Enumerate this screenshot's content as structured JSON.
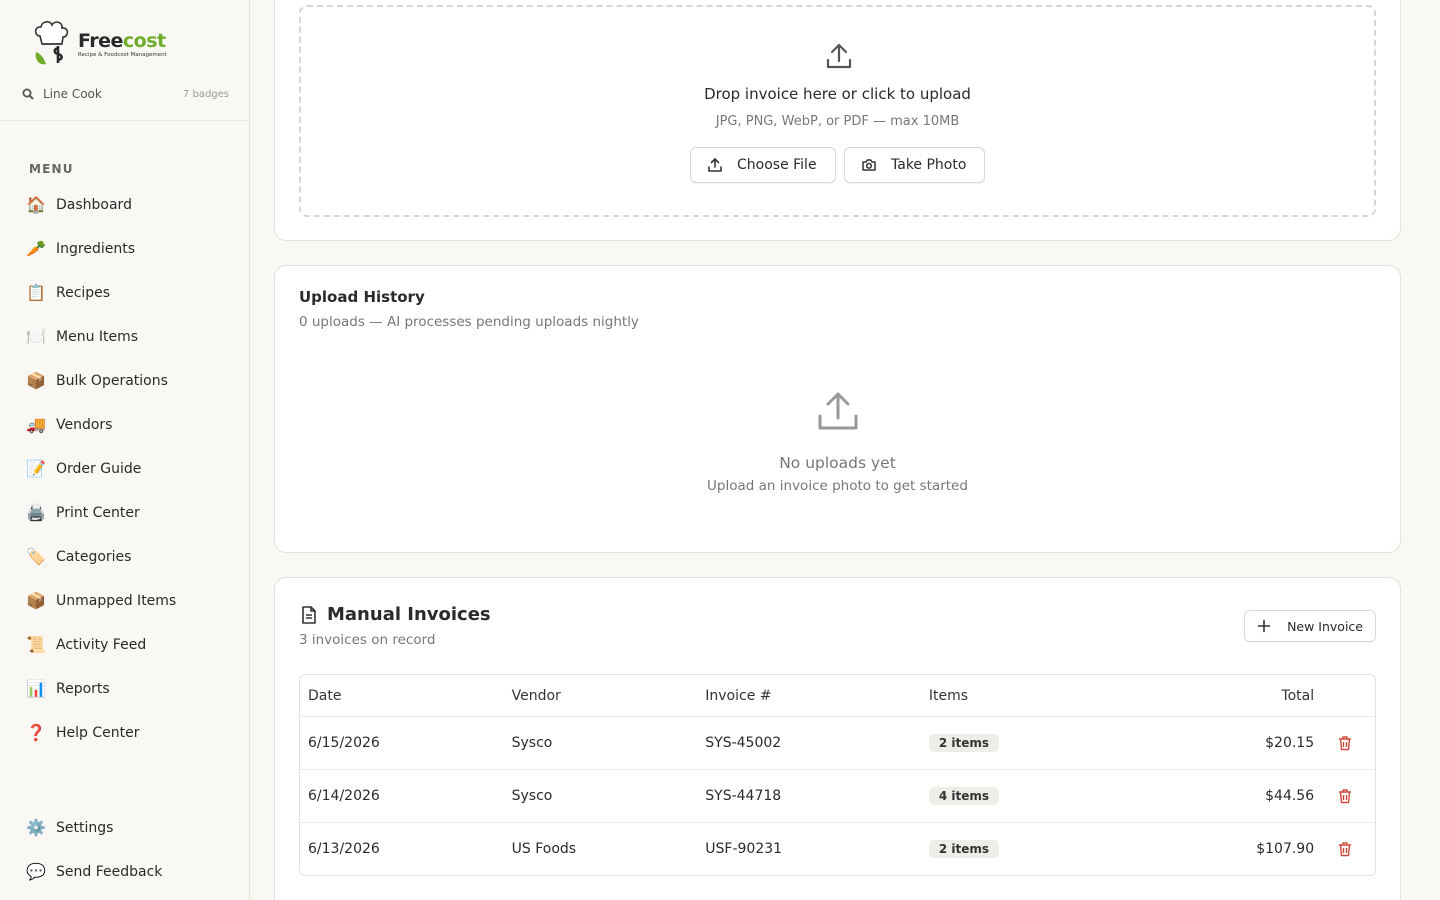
{
  "app": {
    "logo_name_prefix": "Free",
    "logo_name_accent": "cost",
    "logo_tagline": "Recipe & Foodcost Management"
  },
  "user": {
    "role": "Line Cook",
    "badges": "7 badges"
  },
  "sidebar": {
    "menu_label": "MENU",
    "items": [
      {
        "emoji": "🏠",
        "label": "Dashboard"
      },
      {
        "emoji": "🥕",
        "label": "Ingredients"
      },
      {
        "emoji": "📋",
        "label": "Recipes"
      },
      {
        "emoji": "🍽️",
        "label": "Menu Items"
      },
      {
        "emoji": "📦",
        "label": "Bulk Operations"
      },
      {
        "emoji": "🚚",
        "label": "Vendors"
      },
      {
        "emoji": "📝",
        "label": "Order Guide"
      },
      {
        "emoji": "🖨️",
        "label": "Print Center"
      },
      {
        "emoji": "🏷️",
        "label": "Categories"
      },
      {
        "emoji": "📦",
        "label": "Unmapped Items"
      },
      {
        "emoji": "📜",
        "label": "Activity Feed"
      },
      {
        "emoji": "📊",
        "label": "Reports"
      },
      {
        "emoji": "❓",
        "label": "Help Center"
      }
    ],
    "bottom_items": [
      {
        "emoji": "⚙️",
        "label": "Settings"
      },
      {
        "emoji": "💬",
        "label": "Send Feedback"
      }
    ]
  },
  "upload": {
    "title": "Drop invoice here or click to upload",
    "subtitle": "JPG, PNG, WebP, or PDF — max 10MB",
    "choose_file_label": "Choose File",
    "take_photo_label": "Take Photo"
  },
  "history": {
    "title": "Upload History",
    "subtitle": "0 uploads — AI processes pending uploads nightly",
    "empty_title": "No uploads yet",
    "empty_subtitle": "Upload an invoice photo to get started"
  },
  "invoices": {
    "title": "Manual Invoices",
    "subtitle": "3 invoices on record",
    "new_button_label": "New Invoice",
    "columns": {
      "date": "Date",
      "vendor": "Vendor",
      "invoice_no": "Invoice #",
      "items": "Items",
      "total": "Total"
    },
    "rows": [
      {
        "date": "6/15/2026",
        "vendor": "Sysco",
        "invoice_no": "SYS-45002",
        "items": "2 items",
        "total": "$20.15"
      },
      {
        "date": "6/14/2026",
        "vendor": "Sysco",
        "invoice_no": "SYS-44718",
        "items": "4 items",
        "total": "$44.56"
      },
      {
        "date": "6/13/2026",
        "vendor": "US Foods",
        "invoice_no": "USF-90231",
        "items": "2 items",
        "total": "$107.90"
      }
    ]
  },
  "colors": {
    "brand_green": "#6fae2c",
    "danger": "#d04a3c",
    "background": "#faf8f4"
  }
}
